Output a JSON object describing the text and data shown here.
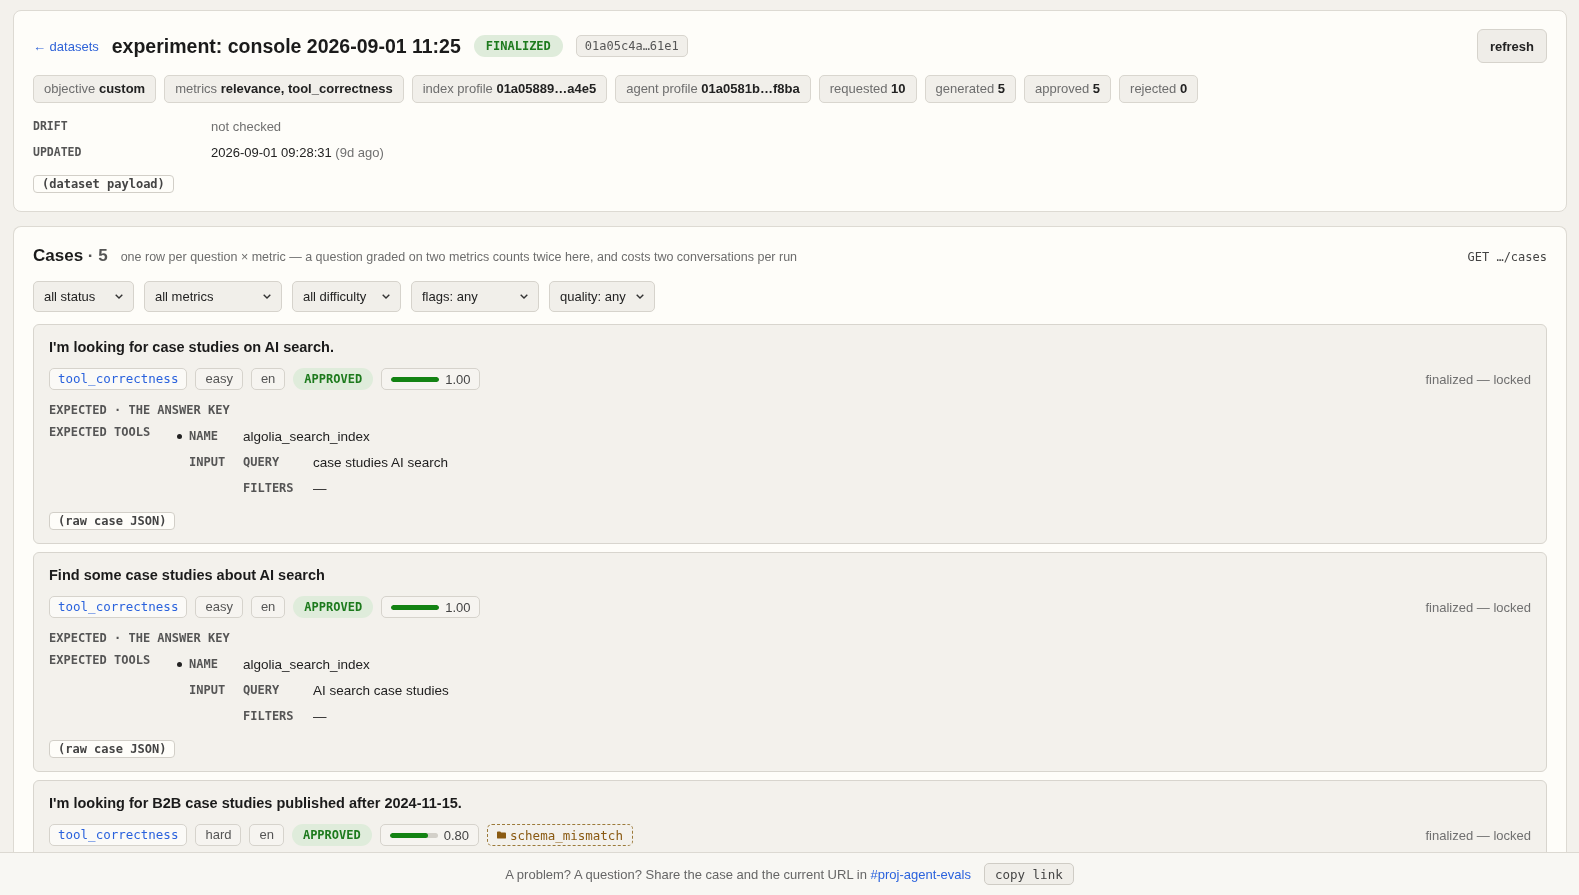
{
  "header": {
    "back_link": "← datasets",
    "title": "experiment: console 2026-09-01 11:25",
    "status": "FINALIZED",
    "id": "01a05c4a…61e1",
    "refresh_button": "refresh"
  },
  "stats": [
    {
      "label": "objective",
      "value": "custom"
    },
    {
      "label": "metrics",
      "value": "relevance, tool_correctness"
    },
    {
      "label": "index profile",
      "value": "01a05889…a4e5"
    },
    {
      "label": "agent profile",
      "value": "01a0581b…f8ba"
    },
    {
      "label": "requested",
      "value": "10"
    },
    {
      "label": "generated",
      "value": "5"
    },
    {
      "label": "approved",
      "value": "5"
    },
    {
      "label": "rejected",
      "value": "0"
    }
  ],
  "details": [
    {
      "label": "DRIFT",
      "value": "not checked",
      "muted": true
    },
    {
      "label": "UPDATED",
      "value": "2026-09-01 09:28:31",
      "note": "(9d ago)",
      "muted": false
    }
  ],
  "payload_toggle": "(dataset payload)",
  "cases": {
    "title": "Cases",
    "count": "· 5",
    "hint": "one row per question × metric — a question graded on two metrics counts twice here, and costs two conversations per run",
    "endpoint": "GET …/cases",
    "filters": [
      "all status",
      "all metrics",
      "all difficulty",
      "flags: any",
      "quality: any"
    ],
    "items": [
      {
        "question": "I'm looking for case studies on AI search.",
        "metric": "tool_correctness",
        "difficulty": "easy",
        "language": "en",
        "status": "APPROVED",
        "score": {
          "level": 1.0,
          "reading": "1.00"
        },
        "lock_note": "finalized — locked",
        "expected": {
          "heading": "EXPECTED · THE ANSWER KEY",
          "tools_label": "EXPECTED TOOLS",
          "tools": [
            {
              "name_label": "NAME",
              "name": "algolia_search_index",
              "input_label": "INPUT",
              "inputs": [
                {
                  "key": "QUERY",
                  "value": "case studies AI search"
                },
                {
                  "key": "FILTERS",
                  "value": "—"
                }
              ]
            }
          ]
        },
        "raw_toggle": "(raw case JSON)"
      },
      {
        "question": "Find some case studies about AI search",
        "metric": "tool_correctness",
        "difficulty": "easy",
        "language": "en",
        "status": "APPROVED",
        "score": {
          "level": 1.0,
          "reading": "1.00"
        },
        "lock_note": "finalized — locked",
        "expected": {
          "heading": "EXPECTED · THE ANSWER KEY",
          "tools_label": "EXPECTED TOOLS",
          "tools": [
            {
              "name_label": "NAME",
              "name": "algolia_search_index",
              "input_label": "INPUT",
              "inputs": [
                {
                  "key": "QUERY",
                  "value": "AI search case studies"
                },
                {
                  "key": "FILTERS",
                  "value": "—"
                }
              ]
            }
          ]
        },
        "raw_toggle": "(raw case JSON)"
      },
      {
        "question": "I'm looking for B2B case studies published after 2024-11-15.",
        "metric": "tool_correctness",
        "difficulty": "hard",
        "language": "en",
        "status": "APPROVED",
        "score": {
          "level": 0.8,
          "reading": "0.80"
        },
        "flags": [
          {
            "label": "schema_mismatch"
          }
        ],
        "lock_note": "finalized — locked"
      }
    ]
  },
  "footer": {
    "message": "A problem? A question? Share the case and the current URL in",
    "link": "#proj-agent-evals",
    "copy_button": "copy link"
  }
}
